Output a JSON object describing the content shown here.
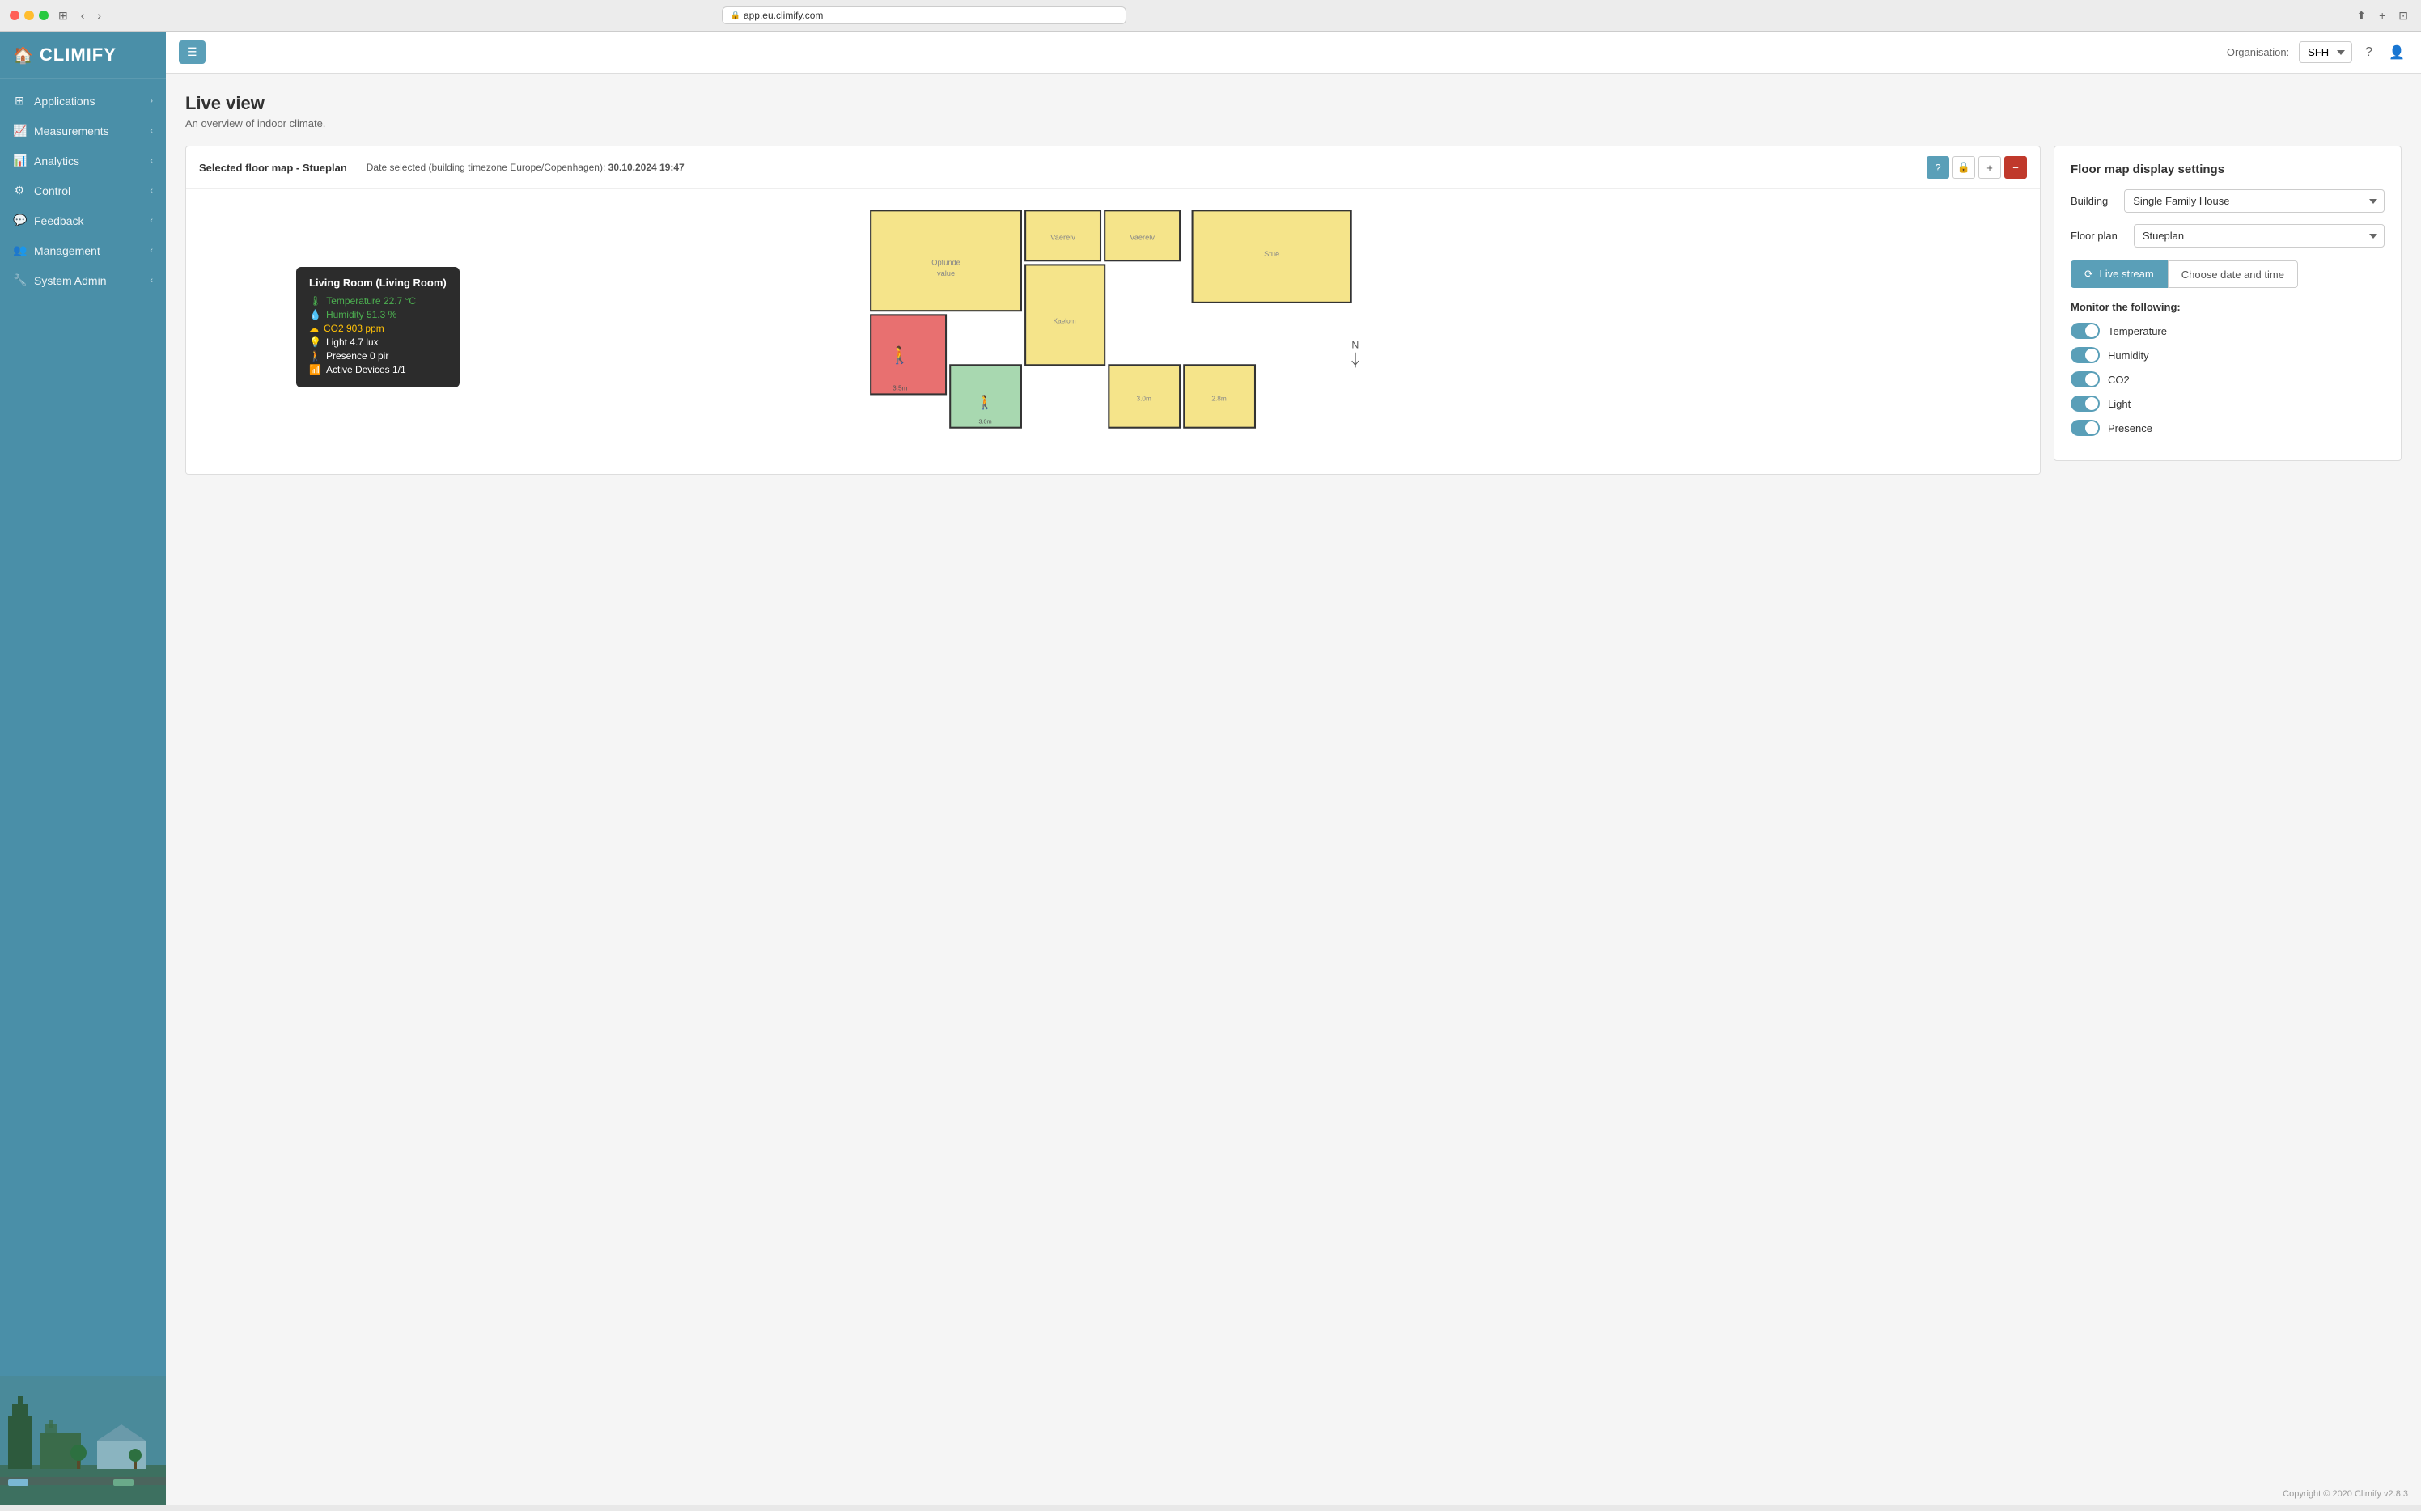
{
  "browser": {
    "url": "app.eu.climify.com"
  },
  "topbar": {
    "menu_label": "☰",
    "org_label": "Organisation:",
    "org_value": "SFH",
    "org_options": [
      "SFH"
    ],
    "help_icon": "?",
    "user_icon": "👤"
  },
  "sidebar": {
    "logo_text": "CLIMIFY",
    "logo_icon": "🏠",
    "items": [
      {
        "id": "applications",
        "label": "Applications",
        "icon": "⊞",
        "arrow": "›"
      },
      {
        "id": "measurements",
        "label": "Measurements",
        "icon": "📈",
        "arrow": "‹"
      },
      {
        "id": "analytics",
        "label": "Analytics",
        "icon": "📊",
        "arrow": "‹"
      },
      {
        "id": "control",
        "label": "Control",
        "icon": "⚙",
        "arrow": "‹"
      },
      {
        "id": "feedback",
        "label": "Feedback",
        "icon": "💬",
        "arrow": "‹"
      },
      {
        "id": "management",
        "label": "Management",
        "icon": "👥",
        "arrow": "‹"
      },
      {
        "id": "system-admin",
        "label": "System Admin",
        "icon": "🔧",
        "arrow": "‹"
      }
    ]
  },
  "page": {
    "title": "Live view",
    "subtitle": "An overview of indoor climate."
  },
  "floor_panel": {
    "map_label": "Selected floor map - Stueplan",
    "date_prefix": "Date selected (building timezone Europe/Copenhagen):",
    "date_value": "30.10.2024 19:47",
    "btn_help": "?",
    "btn_lock": "🔒",
    "btn_plus": "+",
    "btn_minus": "−"
  },
  "tooltip": {
    "title": "Living Room (Living Room)",
    "rows": [
      {
        "icon": "🌡",
        "label": "Temperature 22.7 °C",
        "color": "green"
      },
      {
        "icon": "💧",
        "label": "Humidity 51.3 %",
        "color": "green"
      },
      {
        "icon": "☁",
        "label": "CO2 903 ppm",
        "color": "yellow"
      },
      {
        "icon": "💡",
        "label": "Light 4.7 lux",
        "color": "white"
      },
      {
        "icon": "🚶",
        "label": "Presence 0 pir",
        "color": "white"
      },
      {
        "icon": "📶",
        "label": "Active Devices 1/1",
        "color": "white"
      }
    ]
  },
  "settings_panel": {
    "title": "Floor map display settings",
    "building_label": "Building",
    "building_value": "Single Family House",
    "floor_plan_label": "Floor plan",
    "floor_plan_value": "Stueplan",
    "live_stream_label": "Live stream",
    "choose_date_label": "Choose date and time",
    "monitor_title": "Monitor the following:",
    "monitors": [
      {
        "label": "Temperature",
        "enabled": true
      },
      {
        "label": "Humidity",
        "enabled": true
      },
      {
        "label": "CO2",
        "enabled": true
      },
      {
        "label": "Light",
        "enabled": true
      },
      {
        "label": "Presence",
        "enabled": true
      }
    ]
  },
  "footer": {
    "copyright": "Copyright © 2020 Climify   v2.8.3"
  }
}
